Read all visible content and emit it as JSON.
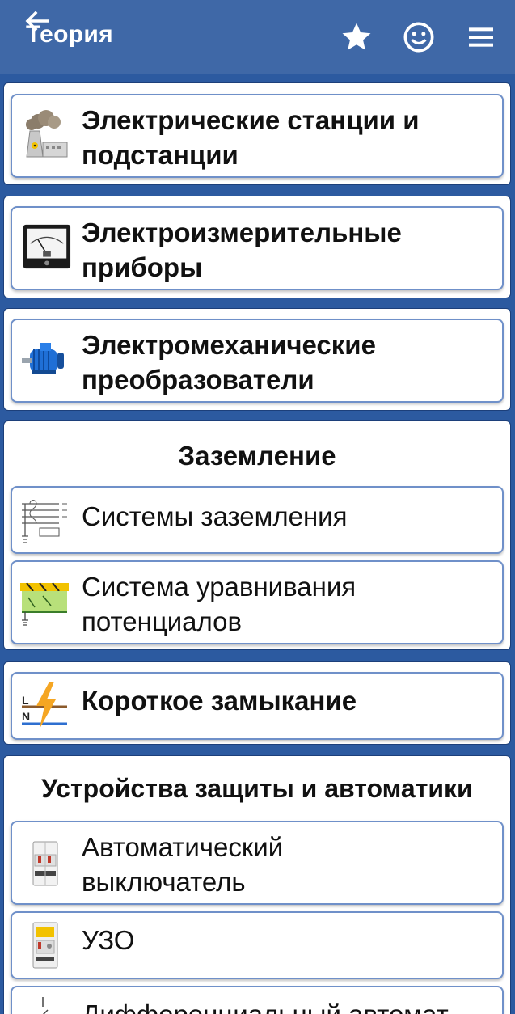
{
  "appbar": {
    "title": "Теория",
    "back_icon": "arrow-back-icon",
    "actions": [
      "star-icon",
      "smiley-icon",
      "menu-icon"
    ]
  },
  "colors": {
    "appbar": "#3f68a7",
    "background": "#2c5aa0",
    "card_border": "#6f90c9",
    "text": "#111111"
  },
  "cards": {
    "stations": {
      "line1": "Электрические станции и",
      "line2": "подстанции",
      "icon": "power-plant-icon"
    },
    "instruments": {
      "line1": "Электроизмерительные",
      "line2": "приборы",
      "icon": "meter-icon"
    },
    "converters": {
      "line1": "Электромеханические",
      "line2": "преобразователи",
      "icon": "motor-icon"
    },
    "short_circuit": {
      "label": "Короткое замыкание",
      "icon": "lightning-icon"
    }
  },
  "grounding": {
    "header": "Заземление",
    "items": [
      {
        "line1": "Системы заземления",
        "icon": "grounding-diagram-icon"
      },
      {
        "line1": "Система уравнивания",
        "line2": "потенциалов",
        "icon": "equipotential-icon"
      }
    ]
  },
  "protection": {
    "header": "Устройства защиты и автоматики",
    "items": [
      {
        "line1": "Автоматический",
        "line2": "выключатель",
        "icon": "circuit-breaker-icon"
      },
      {
        "line1": "УЗО",
        "icon": "rcd-icon"
      },
      {
        "line1": "Дифференциальный автомат",
        "icon": "rcbo-icon"
      }
    ]
  }
}
